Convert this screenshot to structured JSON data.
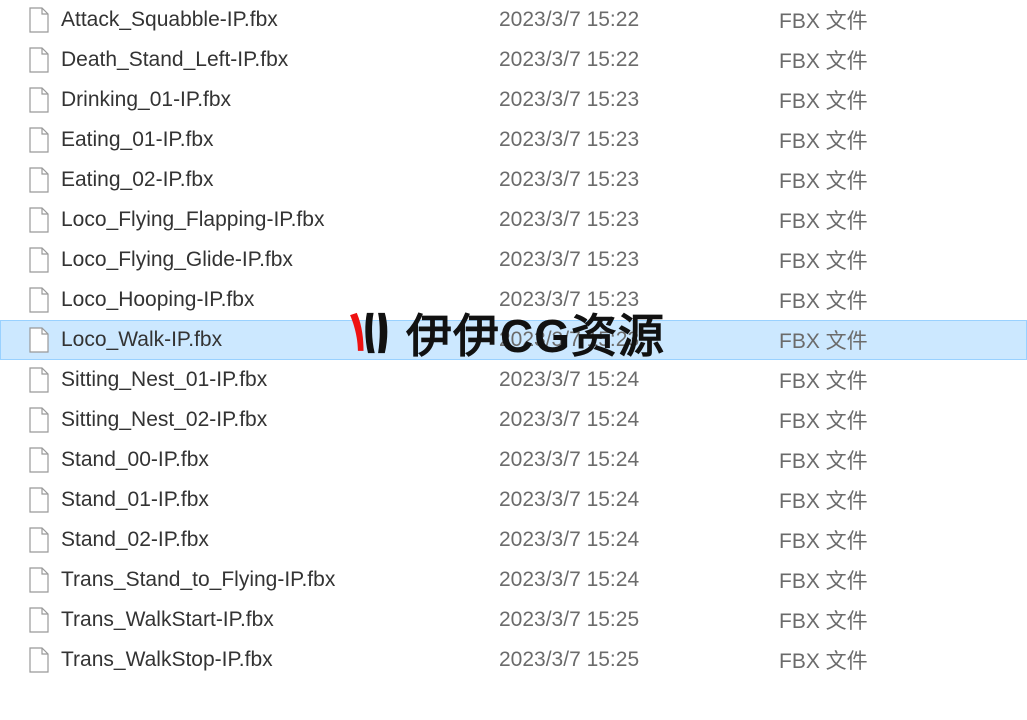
{
  "files": [
    {
      "name": "Attack_Squabble-IP.fbx",
      "date": "2023/3/7 15:22",
      "type": "FBX 文件",
      "selected": false
    },
    {
      "name": "Death_Stand_Left-IP.fbx",
      "date": "2023/3/7 15:22",
      "type": "FBX 文件",
      "selected": false
    },
    {
      "name": "Drinking_01-IP.fbx",
      "date": "2023/3/7 15:23",
      "type": "FBX 文件",
      "selected": false
    },
    {
      "name": "Eating_01-IP.fbx",
      "date": "2023/3/7 15:23",
      "type": "FBX 文件",
      "selected": false
    },
    {
      "name": "Eating_02-IP.fbx",
      "date": "2023/3/7 15:23",
      "type": "FBX 文件",
      "selected": false
    },
    {
      "name": "Loco_Flying_Flapping-IP.fbx",
      "date": "2023/3/7 15:23",
      "type": "FBX 文件",
      "selected": false
    },
    {
      "name": "Loco_Flying_Glide-IP.fbx",
      "date": "2023/3/7 15:23",
      "type": "FBX 文件",
      "selected": false
    },
    {
      "name": "Loco_Hooping-IP.fbx",
      "date": "2023/3/7 15:23",
      "type": "FBX 文件",
      "selected": false
    },
    {
      "name": "Loco_Walk-IP.fbx",
      "date": "2023/3/7 15:23",
      "type": "FBX 文件",
      "selected": true
    },
    {
      "name": "Sitting_Nest_01-IP.fbx",
      "date": "2023/3/7 15:24",
      "type": "FBX 文件",
      "selected": false
    },
    {
      "name": "Sitting_Nest_02-IP.fbx",
      "date": "2023/3/7 15:24",
      "type": "FBX 文件",
      "selected": false
    },
    {
      "name": "Stand_00-IP.fbx",
      "date": "2023/3/7 15:24",
      "type": "FBX 文件",
      "selected": false
    },
    {
      "name": "Stand_01-IP.fbx",
      "date": "2023/3/7 15:24",
      "type": "FBX 文件",
      "selected": false
    },
    {
      "name": "Stand_02-IP.fbx",
      "date": "2023/3/7 15:24",
      "type": "FBX 文件",
      "selected": false
    },
    {
      "name": "Trans_Stand_to_Flying-IP.fbx",
      "date": "2023/3/7 15:24",
      "type": "FBX 文件",
      "selected": false
    },
    {
      "name": "Trans_WalkStart-IP.fbx",
      "date": "2023/3/7 15:25",
      "type": "FBX 文件",
      "selected": false
    },
    {
      "name": "Trans_WalkStop-IP.fbx",
      "date": "2023/3/7 15:25",
      "type": "FBX 文件",
      "selected": false
    }
  ],
  "watermark": {
    "text": "伊伊CG资源"
  }
}
